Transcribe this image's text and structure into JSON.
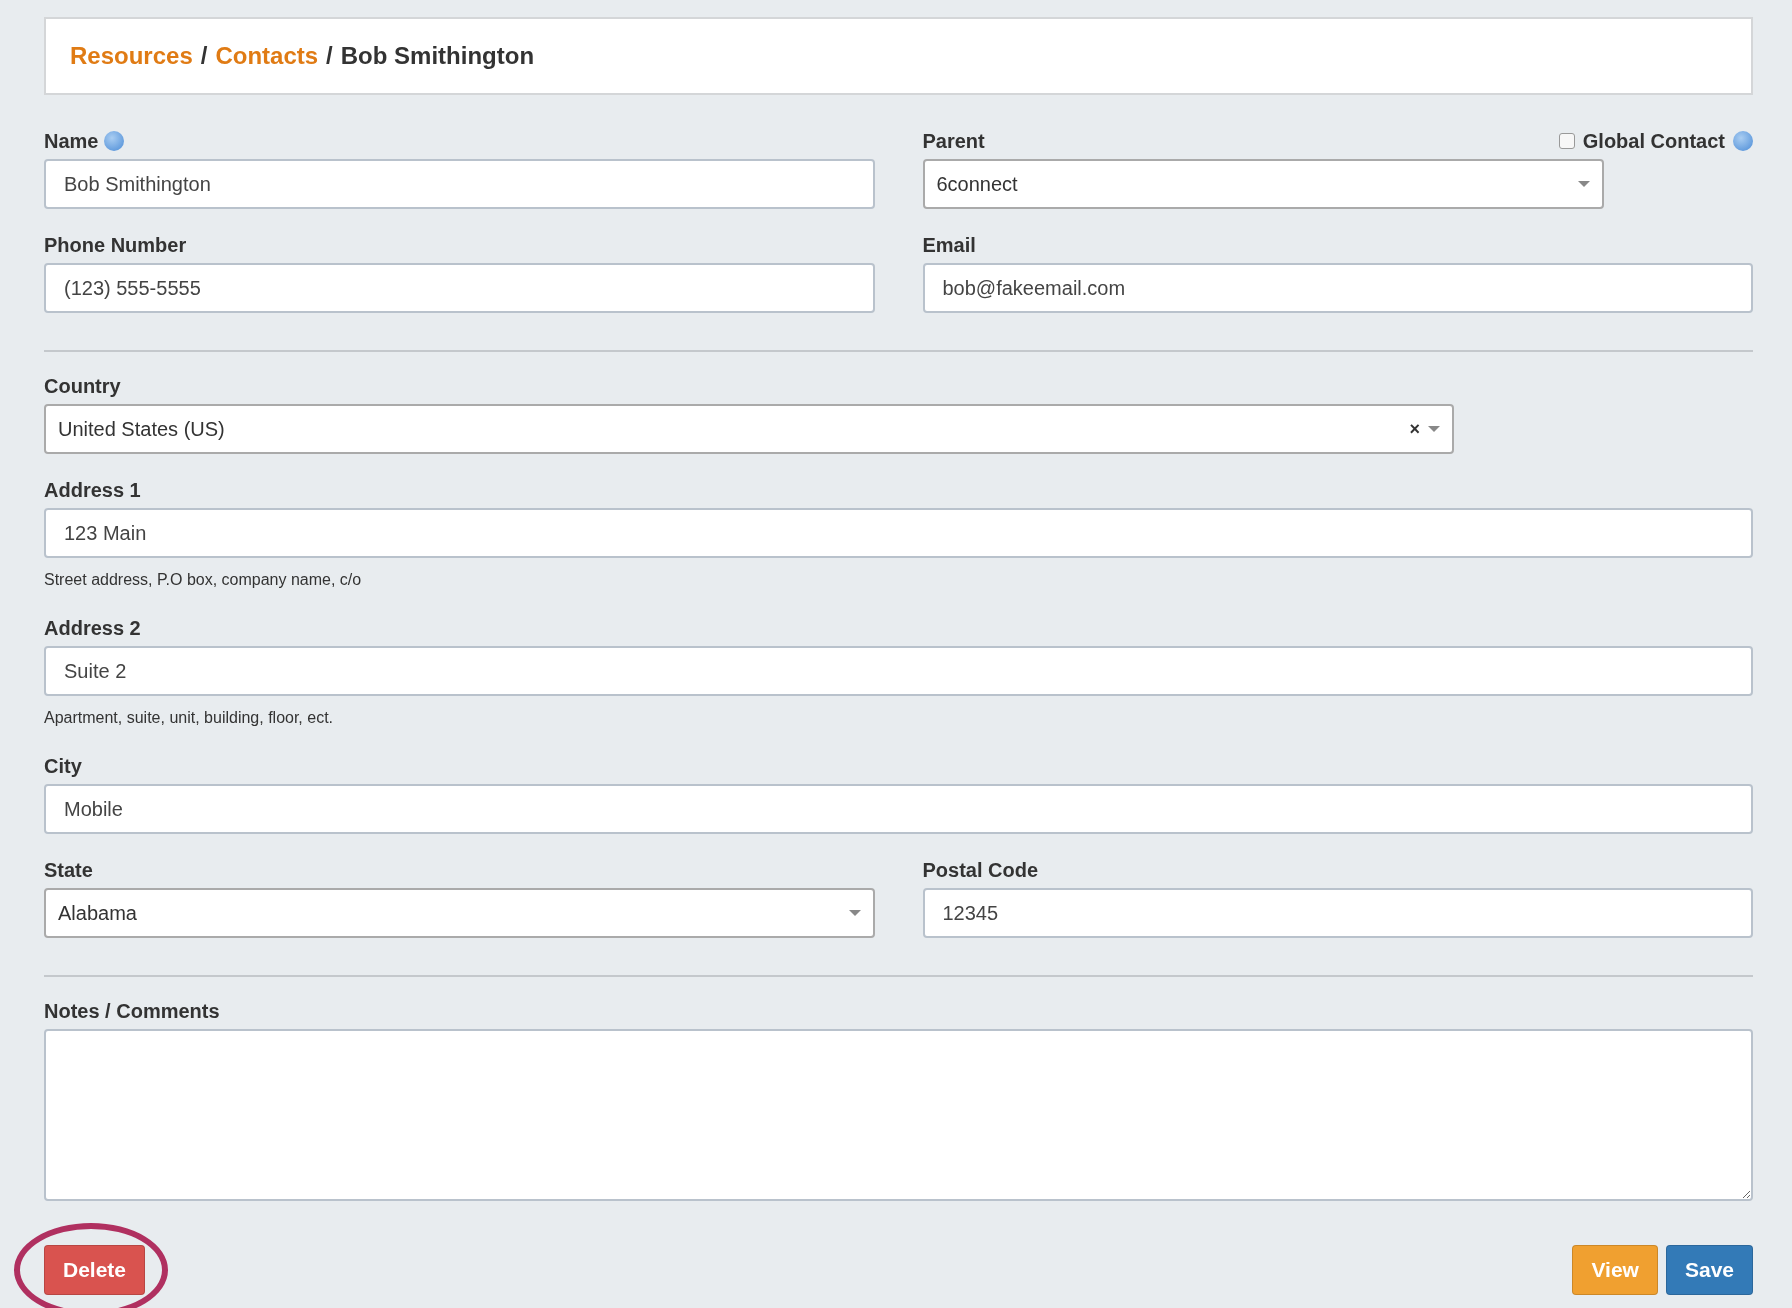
{
  "breadcrumb": [
    {
      "text": "Resources",
      "kind": "link"
    },
    {
      "text": "/",
      "kind": "separator"
    },
    {
      "text": "Contacts",
      "kind": "link"
    },
    {
      "text": "/",
      "kind": "separator"
    },
    {
      "text": "Bob Smithington",
      "kind": "current"
    }
  ],
  "sections": [
    {
      "rows": [
        [
          {
            "label": "Name",
            "kind": "text",
            "value": "Bob Smithington",
            "info": true
          },
          {
            "label": "Parent",
            "kind": "select",
            "value": "6connect",
            "global_contact": {
              "label": "Global Contact",
              "checked": false,
              "info": true
            }
          }
        ],
        [
          {
            "label": "Phone Number",
            "kind": "text",
            "value": "(123) 555-5555"
          },
          {
            "label": "Email",
            "kind": "text",
            "value": "bob@fakeemail.com"
          }
        ]
      ]
    },
    {
      "rows": [
        [
          {
            "label": "Country",
            "kind": "select",
            "value": "United States (US)",
            "clear_icon": "×"
          }
        ],
        [
          {
            "label": "Address 1",
            "kind": "text",
            "value": "123 Main",
            "help": "Street address, P.O box, company name, c/o"
          }
        ],
        [
          {
            "label": "Address 2",
            "kind": "text",
            "value": "Suite 2",
            "help": "Apartment, suite, unit, building, floor, ect."
          }
        ],
        [
          {
            "label": "City",
            "kind": "text",
            "value": "Mobile"
          }
        ],
        [
          {
            "label": "State",
            "kind": "select",
            "value": "Alabama"
          },
          {
            "label": "Postal Code",
            "kind": "text",
            "value": "12345"
          }
        ]
      ]
    },
    {
      "rows": [
        [
          {
            "label": "Notes / Comments",
            "kind": "textarea"
          }
        ]
      ]
    }
  ],
  "buttons": [
    {
      "label": "Delete",
      "kind": "danger",
      "circled": true
    },
    {
      "label": "View",
      "kind": "warning",
      "circled": false
    },
    {
      "label": "Save",
      "kind": "primary",
      "circled": false
    }
  ]
}
